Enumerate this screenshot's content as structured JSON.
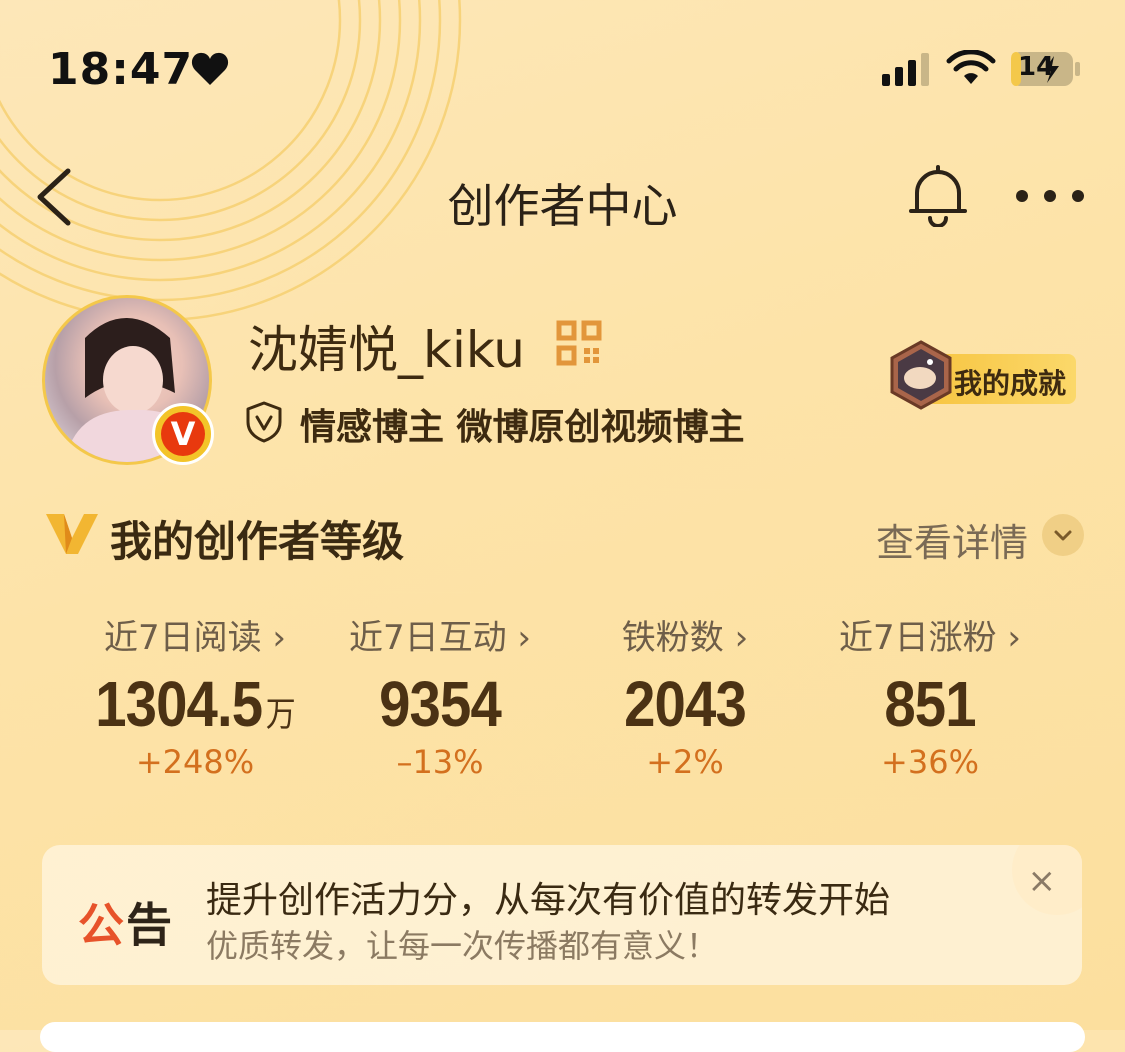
{
  "status_bar": {
    "time": "18:47",
    "battery": "14"
  },
  "nav": {
    "title": "创作者中心"
  },
  "profile": {
    "username": "沈婧悦_kiku",
    "verify_letter": "V",
    "tags": "情感博主 微博原创视频博主",
    "achievement_label": "我的成就"
  },
  "level": {
    "title": "我的创作者等级",
    "detail_label": "查看详情"
  },
  "stats": [
    {
      "label": "近7日阅读 ›",
      "value": "1304.5",
      "unit": "万",
      "change": "+248%"
    },
    {
      "label": "近7日互动 ›",
      "value": "9354",
      "unit": "",
      "change": "–13%"
    },
    {
      "label": "铁粉数 ›",
      "value": "2043",
      "unit": "",
      "change": "+2%"
    },
    {
      "label": "近7日涨粉 ›",
      "value": "851",
      "unit": "",
      "change": "+36%"
    }
  ],
  "notice": {
    "tag_first": "公",
    "tag_second": "告",
    "line1": "提升创作活力分，从每次有价值的转发开始",
    "line2": "优质转发，让每一次传播都有意义！",
    "close": "×"
  },
  "colors": {
    "accent": "#d3701e",
    "notice_red": "#e7532a",
    "badge_red": "#e8390e",
    "gold": "#f4c84a"
  }
}
